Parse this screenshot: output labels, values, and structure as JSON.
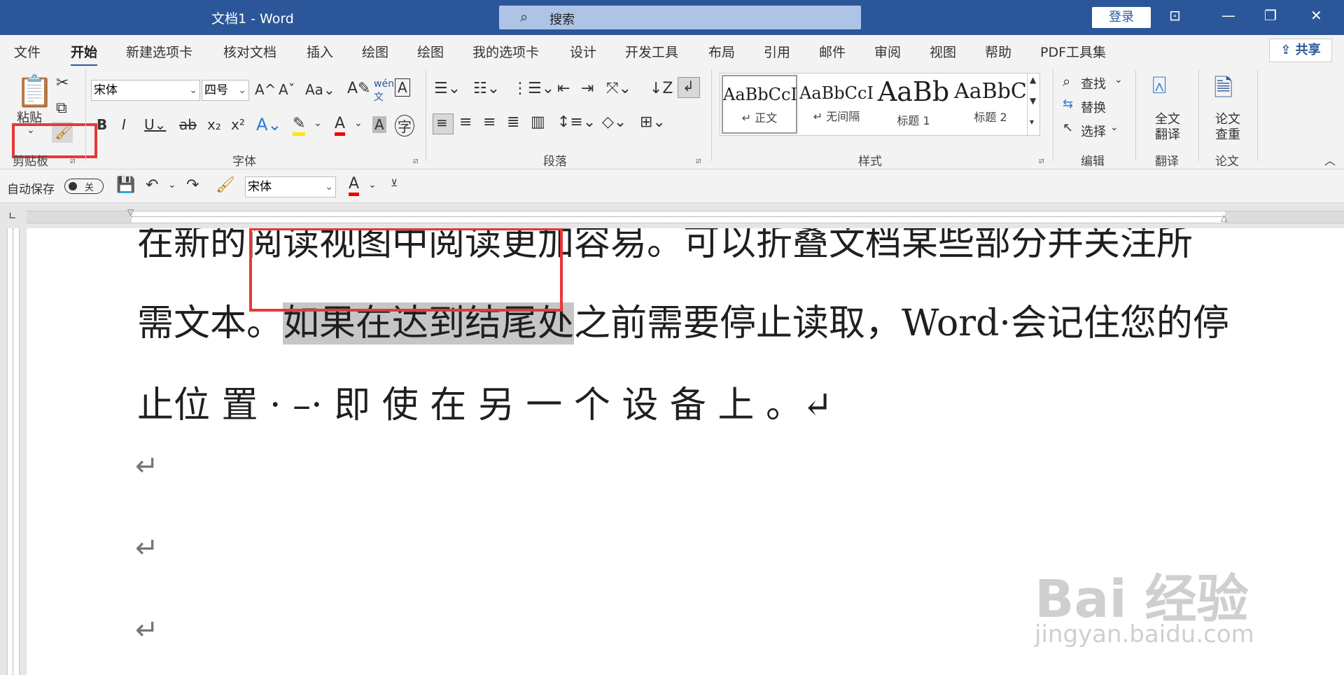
{
  "titlebar": {
    "title": "文档1  -  Word",
    "search_placeholder": "搜索",
    "login": "登录"
  },
  "menu": {
    "tabs": [
      "文件",
      "开始",
      "新建选项卡",
      "核对文档",
      "插入",
      "绘图",
      "绘图",
      "我的选项卡",
      "设计",
      "开发工具",
      "布局",
      "引用",
      "邮件",
      "审阅",
      "视图",
      "帮助",
      "PDF工具集"
    ],
    "active": "开始",
    "share": "共享"
  },
  "ribbon": {
    "clipboard": {
      "paste": "粘贴",
      "label": "剪贴板"
    },
    "font": {
      "name": "宋体",
      "size": "四号",
      "label": "字体"
    },
    "paragraph": {
      "label": "段落"
    },
    "styles": {
      "label": "样式",
      "items": [
        {
          "preview": "AaBbCcI",
          "name": "↵ 正文"
        },
        {
          "preview": "AaBbCcI",
          "name": "↵ 无间隔"
        },
        {
          "preview": "AaBb",
          "name": "标题 1"
        },
        {
          "preview": "AaBbC",
          "name": "标题 2"
        }
      ]
    },
    "editing": {
      "find": "查找",
      "replace": "替换",
      "select": "选择",
      "label": "编辑"
    },
    "translate": {
      "full": "全文\n翻译",
      "full_line1": "全文",
      "full_line2": "翻译",
      "label": "翻译"
    },
    "paper": {
      "line1": "论文",
      "line2": "查重",
      "label": "论文"
    }
  },
  "qat": {
    "autosave": "自动保存",
    "toggle": "关",
    "font": "宋体"
  },
  "document": {
    "line0": "在新的阅读视图中阅读更加容易。可以折叠文档某些部分并关注所",
    "line1_pre": "需文本。",
    "line1_sel": "如果在达到结尾处",
    "line1_post": "之前需要停止读取，Word·会记住您的停",
    "line2": "止位 置 · –· 即 使 在 另 一 个 设 备 上 。↵",
    "para_mark": "↵"
  },
  "watermark": {
    "brand": "Bai 经验",
    "url": "jingyan.baidu.com"
  }
}
